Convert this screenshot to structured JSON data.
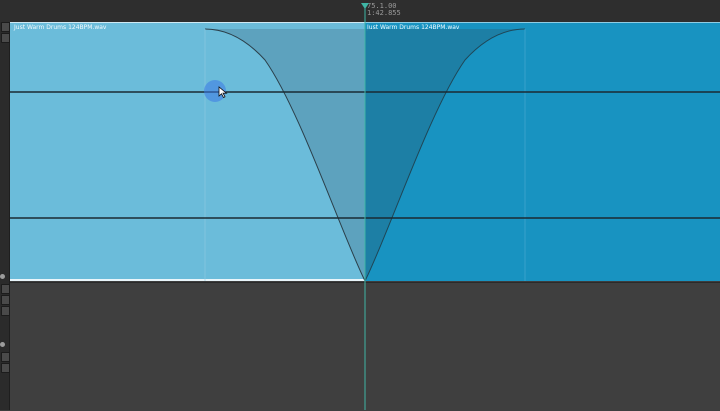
{
  "ruler": {
    "position_bar_beat": "75.1.00",
    "position_time": "1:42.855"
  },
  "clips": {
    "left_name": "Just Warm Drums 124BPM.wav",
    "right_name": "Just Warm Drums 124BPM.wav"
  },
  "crossfade": {
    "shape": "equal-power"
  },
  "icons": [
    "mouse-pointer-icon",
    "playhead-marker-icon"
  ],
  "colors": {
    "ruler_bg": "#2e2e2e",
    "clip_left": "#6bbcda",
    "clip_right": "#1893c1",
    "crossfade_left_shade": "#5c9fba",
    "crossfade_right_shade": "#1e7da2",
    "playhead": "#3fb5a5",
    "waveform": "#1a2a33",
    "empty_lane": "#3f3f3f"
  }
}
